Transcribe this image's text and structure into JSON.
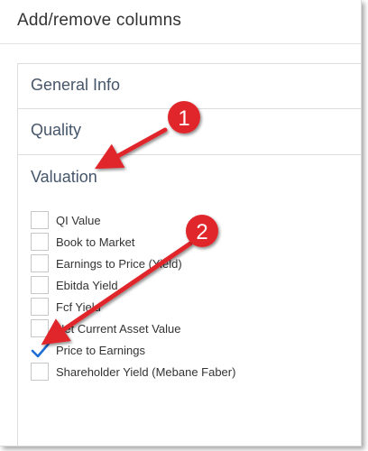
{
  "header": {
    "title": "Add/remove columns"
  },
  "sections": [
    {
      "label": "General Info",
      "expanded": false
    },
    {
      "label": "Quality",
      "expanded": false
    },
    {
      "label": "Valuation",
      "expanded": true
    }
  ],
  "valuation_options": [
    {
      "label": "QI Value",
      "checked": false
    },
    {
      "label": "Book to Market",
      "checked": false
    },
    {
      "label": "Earnings to Price (Yield)",
      "checked": false
    },
    {
      "label": "Ebitda Yield",
      "checked": false
    },
    {
      "label": "Fcf Yield",
      "checked": false
    },
    {
      "label": "Net Current Asset Value",
      "checked": false
    },
    {
      "label": "Price to Earnings",
      "checked": true
    },
    {
      "label": "Shareholder Yield (Mebane Faber)",
      "checked": false
    }
  ],
  "annotations": [
    {
      "number": "1",
      "color": "#e0262b"
    },
    {
      "number": "2",
      "color": "#e0262b"
    }
  ],
  "colors": {
    "checkmark": "#1f6fd6",
    "section_text": "#46566a",
    "annotation_red": "#e0262b"
  }
}
